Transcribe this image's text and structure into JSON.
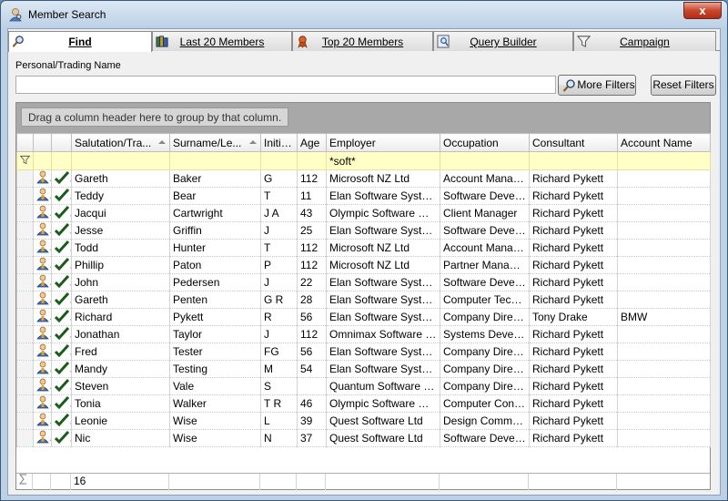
{
  "window": {
    "title": "Member Search",
    "close_label": "x"
  },
  "tabs": [
    {
      "label": "Find",
      "icon": "magnifier-icon",
      "active": true
    },
    {
      "label": "Last 20 Members",
      "icon": "books-icon",
      "active": false
    },
    {
      "label": "Top 20 Members",
      "icon": "ribbon-award-icon",
      "active": false
    },
    {
      "label": "Query Builder",
      "icon": "query-builder-icon",
      "active": false
    },
    {
      "label": "Campaign",
      "icon": "funnel-icon",
      "active": false
    }
  ],
  "search": {
    "label": "Personal/Trading Name",
    "value": "",
    "placeholder": ""
  },
  "buttons": {
    "more_filters": "More Filters",
    "reset_filters": "Reset Filters"
  },
  "grid": {
    "group_hint": "Drag a column header here to group by that column.",
    "columns": [
      "Salutation/Tra...",
      "Surname/Le...",
      "Initials",
      "Age",
      "Employer",
      "Occupation",
      "Consultant",
      "Account Name"
    ],
    "filter": {
      "employer": "*soft*"
    },
    "rows": [
      [
        "Gareth",
        "Baker",
        "G",
        "112",
        "Microsoft NZ Ltd",
        "Account Manager",
        "Richard Pykett",
        ""
      ],
      [
        "Teddy",
        "Bear",
        "T",
        "11",
        "Elan Software System...",
        "Software Devel...",
        "Richard Pykett",
        ""
      ],
      [
        "Jacqui",
        "Cartwright",
        "J A",
        "43",
        "Olympic Software NZ ...",
        "Client Manager",
        "Richard Pykett",
        ""
      ],
      [
        "Jesse",
        "Griffin",
        "J",
        "25",
        "Elan Software System...",
        "Software Devel...",
        "Richard Pykett",
        ""
      ],
      [
        "Todd",
        "Hunter",
        "T",
        "112",
        "Microsoft NZ Ltd",
        "Account Manager",
        "Richard Pykett",
        ""
      ],
      [
        "Phillip",
        "Paton",
        "P",
        "112",
        "Microsoft NZ Ltd",
        "Partner Manage...",
        "Richard Pykett",
        ""
      ],
      [
        "John",
        "Pedersen",
        "J",
        "22",
        "Elan Software System...",
        "Software Devel...",
        "Richard Pykett",
        ""
      ],
      [
        "Gareth",
        "Penten",
        "G R",
        "28",
        "Elan Software System...",
        "Computer Tech...",
        "Richard Pykett",
        ""
      ],
      [
        "Richard",
        "Pykett",
        "R",
        "56",
        "Elan Software System...",
        "Company Director",
        "Tony Drake",
        "BMW"
      ],
      [
        "Jonathan",
        "Taylor",
        "J",
        "112",
        "Omnimax Software Sol...",
        "Systems Develo...",
        "Richard Pykett",
        ""
      ],
      [
        "Fred",
        "Tester",
        "FG",
        "56",
        "Elan Software System...",
        "Company Director",
        "Richard Pykett",
        ""
      ],
      [
        "Mandy",
        "Testing",
        "M",
        "54",
        "Elan Software System...",
        "Company Director",
        "Richard Pykett",
        ""
      ],
      [
        "Steven",
        "Vale",
        "S",
        "",
        "Quantum Software Sol...",
        "Company Director",
        "Richard Pykett",
        ""
      ],
      [
        "Tonia",
        "Walker",
        "T R",
        "46",
        "Olympic Software NZ ...",
        "Computer Consu...",
        "Richard Pykett",
        ""
      ],
      [
        "Leonie",
        "Wise",
        "L",
        "39",
        "Quest Software Ltd",
        "Design Commun...",
        "Richard Pykett",
        ""
      ],
      [
        "Nic",
        "Wise",
        "N",
        "37",
        "Quest Software Ltd",
        "Software Devel...",
        "Richard Pykett",
        ""
      ]
    ],
    "summary": {
      "icon": "sigma-icon",
      "count": "16"
    }
  },
  "colors": {
    "filter_row": "#ffffc6",
    "check": "#1a5c1a",
    "person": "#3a6fc4"
  }
}
